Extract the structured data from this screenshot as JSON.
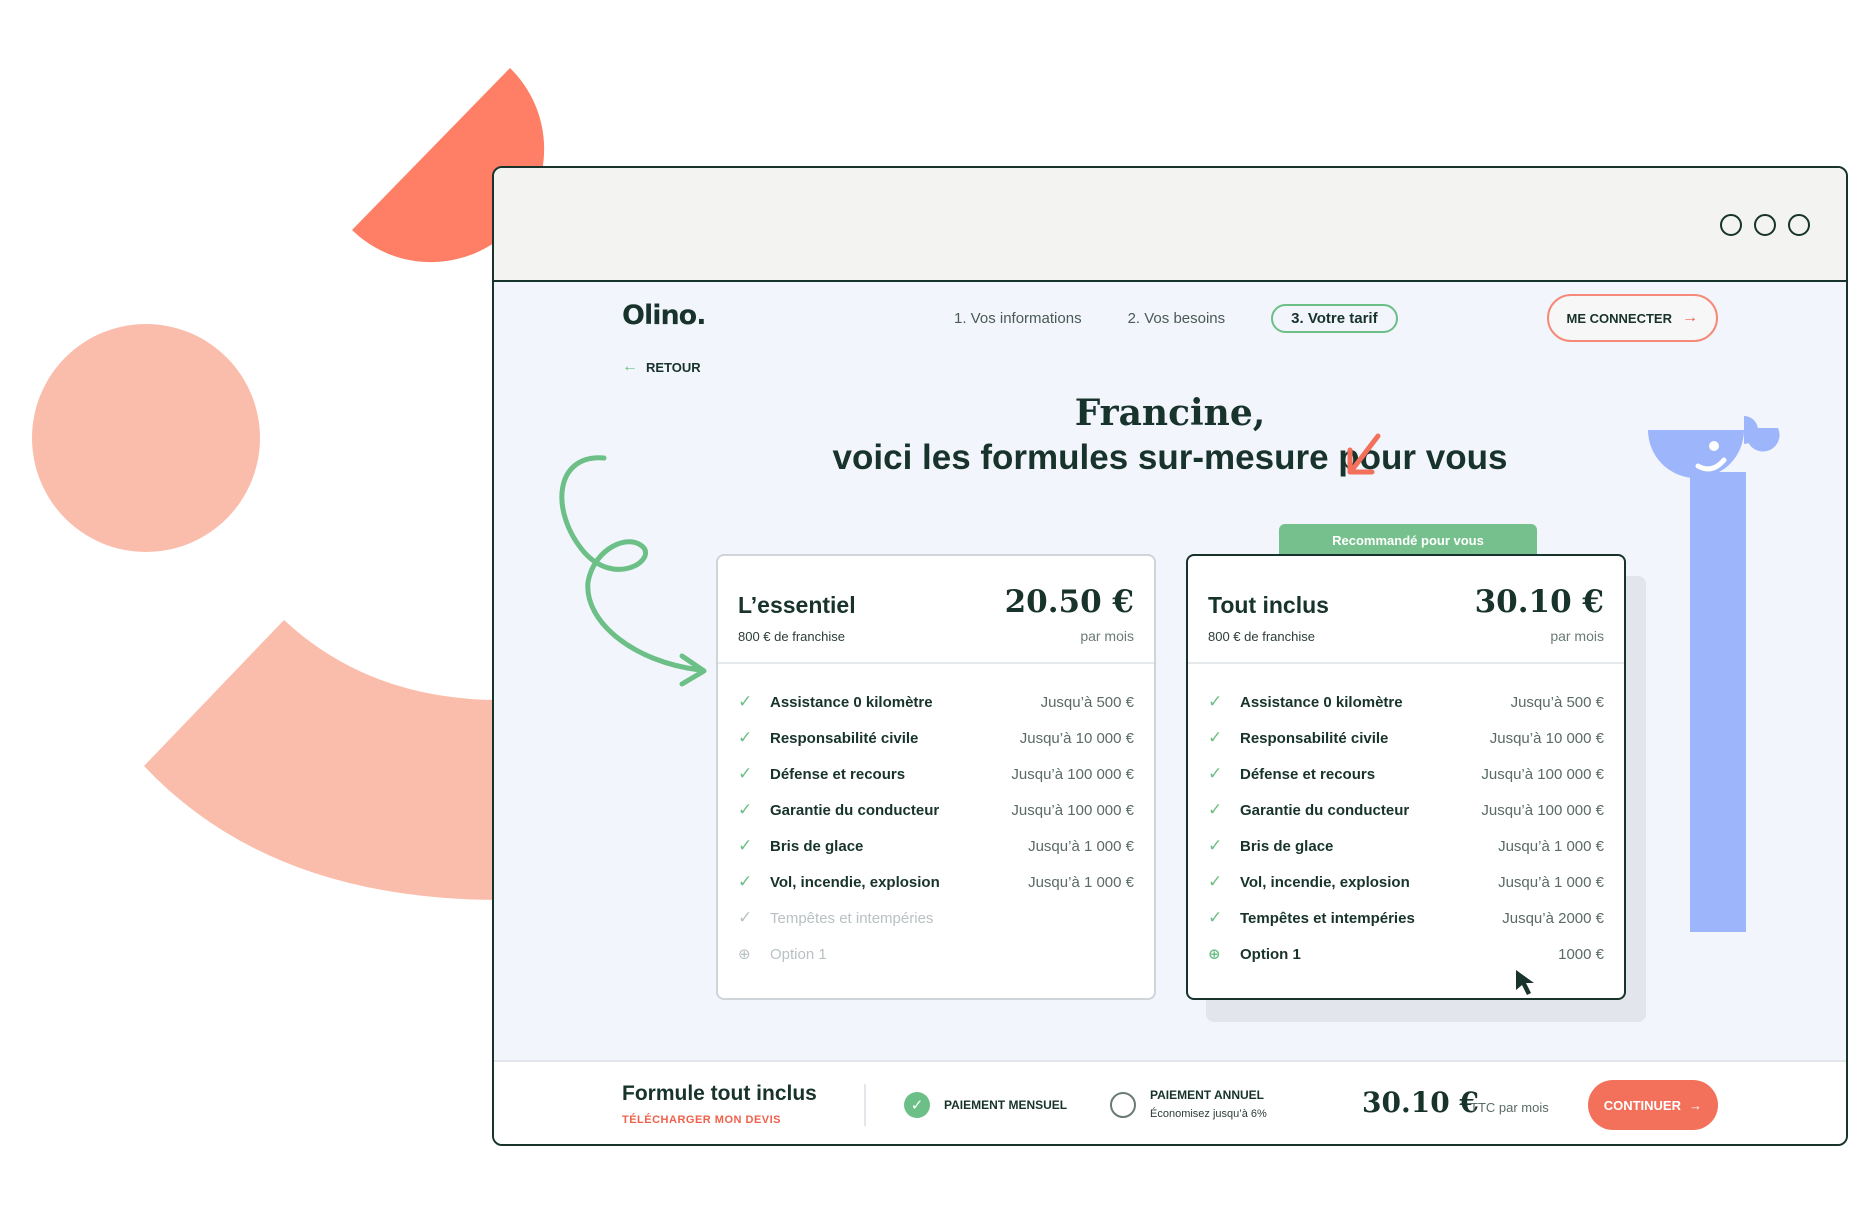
{
  "brand": {
    "logo": "Olino."
  },
  "nav": {
    "back_label": "RETOUR",
    "steps": [
      "1. Vos informations",
      "2. Vos besoins",
      "3. Votre tarif"
    ],
    "login_label": "ME CONNECTER"
  },
  "heading": {
    "line1": "Francine,",
    "line2": "voici les formules sur-mesure pour vous"
  },
  "recommended_badge": "Recommandé pour vous",
  "plans": [
    {
      "title": "L’essentiel",
      "franchise": "800 € de franchise",
      "price": "20.50 €",
      "period": "par mois",
      "features": [
        {
          "name": "Assistance 0 kilomètre",
          "value": "Jusqu’à 500 €",
          "included": true
        },
        {
          "name": "Responsabilité civile",
          "value": "Jusqu’à 10 000 €",
          "included": true
        },
        {
          "name": "Défense et recours",
          "value": "Jusqu’à 100 000 €",
          "included": true
        },
        {
          "name": "Garantie du conducteur",
          "value": "Jusqu’à 100 000 €",
          "included": true
        },
        {
          "name": "Bris de glace",
          "value": "Jusqu’à 1 000 €",
          "included": true
        },
        {
          "name": "Vol, incendie, explosion",
          "value": "Jusqu’à 1 000 €",
          "included": true
        },
        {
          "name": "Tempêtes et intempéries",
          "value": "",
          "included": false
        },
        {
          "name": "Option 1",
          "value": "",
          "included": false
        }
      ]
    },
    {
      "title": "Tout inclus",
      "franchise": "800 € de franchise",
      "price": "30.10 €",
      "period": "par mois",
      "features": [
        {
          "name": "Assistance 0 kilomètre",
          "value": "Jusqu’à 500 €",
          "included": true
        },
        {
          "name": "Responsabilité civile",
          "value": "Jusqu’à 10 000 €",
          "included": true
        },
        {
          "name": "Défense et recours",
          "value": "Jusqu’à 100 000 €",
          "included": true
        },
        {
          "name": "Garantie du conducteur",
          "value": "Jusqu’à 100 000 €",
          "included": true
        },
        {
          "name": "Bris de glace",
          "value": "Jusqu’à 1 000 €",
          "included": true
        },
        {
          "name": "Vol, incendie, explosion",
          "value": "Jusqu’à 1 000 €",
          "included": true
        },
        {
          "name": "Tempêtes et intempéries",
          "value": "Jusqu’à 2000 €",
          "included": true
        },
        {
          "name": "Option 1",
          "value": "1000 €",
          "included": true
        }
      ]
    }
  ],
  "footer": {
    "title": "Formule tout inclus",
    "download_label": "TÉLÉCHARGER MON DEVIS",
    "monthly_label": "PAIEMENT MENSUEL",
    "annual_label": "PAIEMENT ANNUEL",
    "annual_sub": "Économisez jusqu’à 6%",
    "price": "30.10 €",
    "price_sub": "TTC par mois",
    "continue_label": "CONTINUER"
  },
  "colors": {
    "dark": "#17332b",
    "green": "#6cbf86",
    "coral": "#f3705b",
    "salmon": "#fbbdab",
    "blue": "#9db6fb"
  },
  "icons": {
    "check": "check-icon",
    "option": "option-icon",
    "arrow_left": "arrow-left-icon",
    "arrow_right": "arrow-right-icon",
    "cursor": "cursor-icon"
  }
}
